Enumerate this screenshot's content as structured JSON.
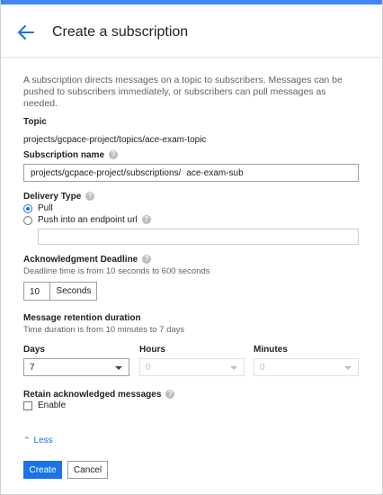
{
  "header": {
    "title": "Create a subscription"
  },
  "description": "A subscription directs messages on a topic to subscribers. Messages can be pushed to subscribers immediately, or subscribers can pull messages as needed.",
  "topic": {
    "label": "Topic",
    "value": "projects/gcpace-project/topics/ace-exam-topic"
  },
  "subscription_name": {
    "label": "Subscription name",
    "prefix": "projects/gcpace-project/subscriptions/",
    "value": "ace-exam-sub"
  },
  "delivery_type": {
    "label": "Delivery Type",
    "options": [
      {
        "label": "Pull",
        "selected": true
      },
      {
        "label": "Push into an endpoint url",
        "selected": false
      }
    ],
    "endpoint_value": ""
  },
  "ack_deadline": {
    "label": "Acknowledgment Deadline",
    "hint": "Deadline time is from 10 seconds to 600 seconds",
    "value": "10",
    "unit": "Seconds"
  },
  "retention": {
    "label": "Message retention duration",
    "hint": "Time duration is from 10 minutes to 7 days",
    "days": {
      "label": "Days",
      "value": "7"
    },
    "hours": {
      "label": "Hours",
      "value": "0"
    },
    "minutes": {
      "label": "Minutes",
      "value": "0"
    }
  },
  "retain_acked": {
    "label": "Retain acknowledged messages",
    "checkbox_label": "Enable",
    "checked": false
  },
  "toggle": {
    "less_label": "Less"
  },
  "actions": {
    "create_label": "Create",
    "cancel_label": "Cancel"
  },
  "colors": {
    "accent": "#1a73e8",
    "topbar": "#4285f4"
  }
}
